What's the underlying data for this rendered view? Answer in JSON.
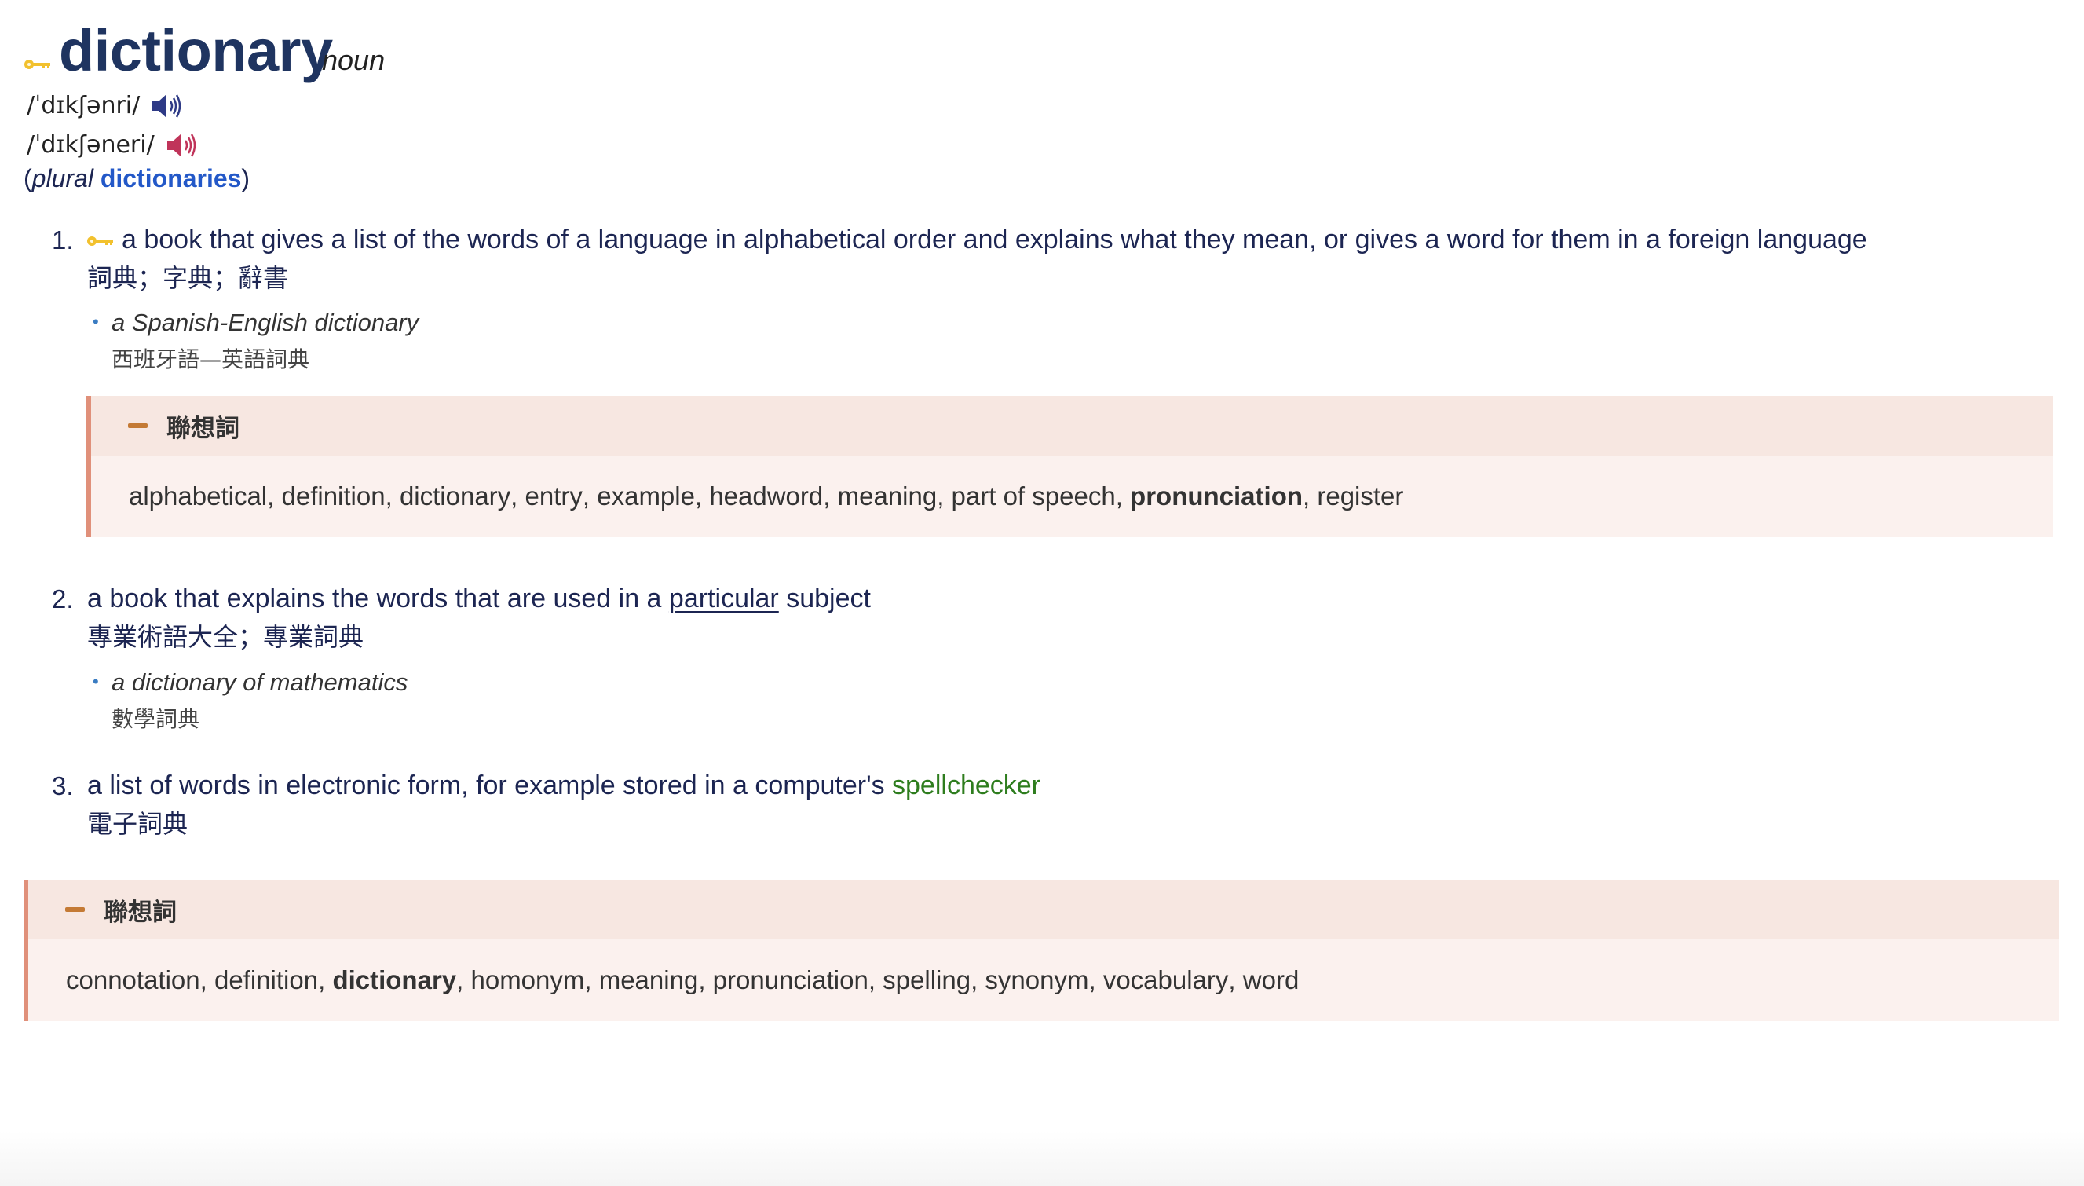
{
  "entry": {
    "headword": "dictionary",
    "part_of_speech": "noun",
    "icons": {
      "headword_key": "key-icon",
      "speaker": "speaker-icon"
    },
    "pronunciations": [
      {
        "ipa": "/ˈdɪkʃənri/",
        "variant": "british",
        "speaker_color": "#2e3a86"
      },
      {
        "ipa": "/ˈdɪkʃəneri/",
        "variant": "american",
        "speaker_color": "#c0345a"
      }
    ],
    "plural": {
      "open_paren": "(",
      "label": "plural",
      "form": "dictionaries",
      "close_paren": ")"
    }
  },
  "definitions": [
    {
      "number": "1.",
      "has_key_icon": true,
      "text_parts": [
        {
          "text": "a book that gives a list of the words of a language in alphabetical order and explains what they mean, or gives a word for them in a foreign language",
          "style": "plain"
        }
      ],
      "zh": "詞典；字典；辭書",
      "examples": [
        {
          "en": "a Spanish-English dictionary",
          "zh": "西班牙語—英語詞典"
        }
      ]
    },
    {
      "number": "2.",
      "has_key_icon": false,
      "text_parts": [
        {
          "text": "a book that explains the words that are used in a ",
          "style": "plain"
        },
        {
          "text": "particular",
          "style": "underline-link"
        },
        {
          "text": " subject",
          "style": "plain"
        }
      ],
      "zh": "專業術語大全；專業詞典",
      "examples": [
        {
          "en": "a dictionary of mathematics",
          "zh": "數學詞典"
        }
      ]
    },
    {
      "number": "3.",
      "has_key_icon": false,
      "text_parts": [
        {
          "text": "a list of words in electronic form, for example stored in a computer's ",
          "style": "plain"
        },
        {
          "text": "spellchecker",
          "style": "green-link"
        }
      ],
      "zh": "電子詞典",
      "examples": []
    }
  ],
  "association_boxes": [
    {
      "title": "聯想詞",
      "toggle_symbol": "−",
      "words": [
        {
          "text": "alphabetical",
          "bold": false
        },
        {
          "text": "definition",
          "bold": false
        },
        {
          "text": "dictionary",
          "bold": false
        },
        {
          "text": "entry",
          "bold": false
        },
        {
          "text": "example",
          "bold": false
        },
        {
          "text": "headword",
          "bold": false
        },
        {
          "text": "meaning",
          "bold": false
        },
        {
          "text": "part of speech",
          "bold": false
        },
        {
          "text": "pronunciation",
          "bold": true
        },
        {
          "text": "register",
          "bold": false
        }
      ]
    },
    {
      "title": "聯想詞",
      "toggle_symbol": "−",
      "words": [
        {
          "text": "connotation",
          "bold": false
        },
        {
          "text": "definition",
          "bold": false
        },
        {
          "text": "dictionary",
          "bold": true
        },
        {
          "text": "homonym",
          "bold": false
        },
        {
          "text": "meaning",
          "bold": false
        },
        {
          "text": "pronunciation",
          "bold": false
        },
        {
          "text": "spelling",
          "bold": false
        },
        {
          "text": "synonym",
          "bold": false
        },
        {
          "text": "vocabulary",
          "bold": false
        },
        {
          "text": "word",
          "bold": false
        }
      ]
    }
  ],
  "colors": {
    "headword": "#1f3460",
    "definition_text": "#1c2552",
    "plural_form": "#2358c8",
    "green_link": "#2e7d1e",
    "bullet": "#3a7cc2",
    "box_border": "#e0907a",
    "box_band": "#f7e7e1",
    "box_body": "#fbf1ee",
    "box_dash": "#c47a35",
    "key_icon": "#f2c12e"
  }
}
